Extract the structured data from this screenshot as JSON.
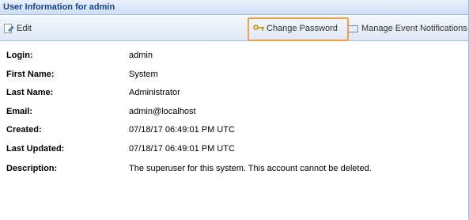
{
  "panel": {
    "title": "User Information for admin"
  },
  "toolbar": {
    "edit_label": "Edit",
    "change_password_label": "Change Password",
    "manage_notifications_label": "Manage Event Notifications"
  },
  "user": {
    "fields": [
      {
        "label": "Login:",
        "value": "admin"
      },
      {
        "label": "First Name:",
        "value": "System"
      },
      {
        "label": "Last Name:",
        "value": "Administrator"
      },
      {
        "label": "Email:",
        "value": "admin@localhost"
      },
      {
        "label": "Created:",
        "value": "07/18/17  06:49:01 PM UTC"
      },
      {
        "label": "Last Updated:",
        "value": "07/18/17  06:49:01 PM UTC"
      },
      {
        "label": "Description:",
        "value": "The superuser for this system. This account cannot be deleted."
      }
    ]
  },
  "colors": {
    "title_text": "#15428b",
    "highlight_border": "#f0a04a",
    "panel_border": "#99bbe8"
  },
  "icons": {
    "edit": "edit-icon",
    "change_password": "key-icon",
    "manage_notifications": "envelope-icon"
  }
}
